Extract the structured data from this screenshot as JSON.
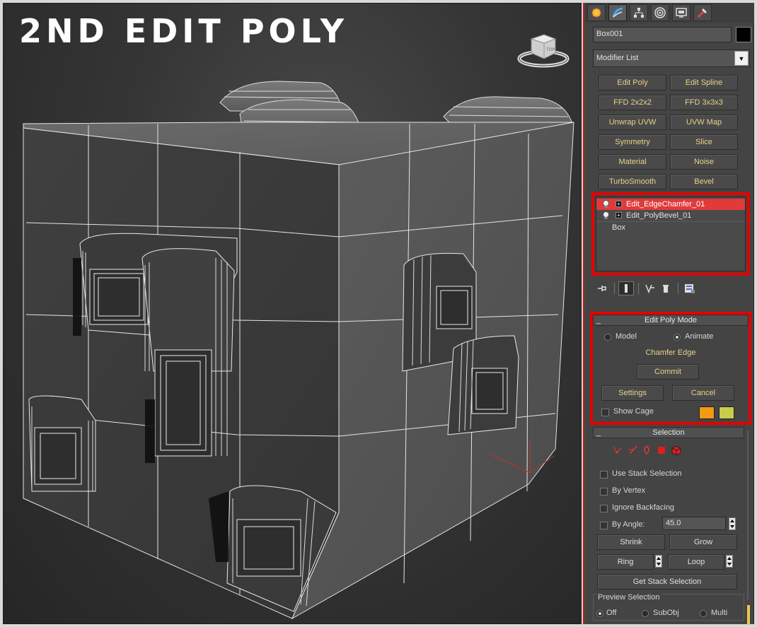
{
  "viewport": {
    "title": "2ND EDIT POLY",
    "viewcube_label": "TOP"
  },
  "panel": {
    "tabs": [
      {
        "icon": "create-icon"
      },
      {
        "icon": "modify-icon"
      },
      {
        "icon": "hierarchy-icon"
      },
      {
        "icon": "motion-icon"
      },
      {
        "icon": "display-icon"
      },
      {
        "icon": "utilities-icon"
      }
    ],
    "object_name": "Box001",
    "object_color": "#000000",
    "modifier_list": "Modifier List",
    "modifier_buttons": [
      "Edit Poly",
      "Edit Spline",
      "FFD 2x2x2",
      "FFD 3x3x3",
      "Unwrap UVW",
      "UVW Map",
      "Symmetry",
      "Slice",
      "Material",
      "Noise",
      "TurboSmooth",
      "Bevel"
    ],
    "stack": [
      {
        "label": "Edit_EdgeChamfer_01",
        "selected": true
      },
      {
        "label": "Edit_PolyBevel_01",
        "selected": false
      },
      {
        "label": "Box",
        "selected": false
      }
    ]
  },
  "edit_poly_mode": {
    "title": "Edit Poly Mode",
    "model_label": "Model",
    "animate_label": "Animate",
    "current_op": "Chamfer Edge",
    "commit_label": "Commit",
    "settings_label": "Settings",
    "cancel_label": "Cancel",
    "show_cage_label": "Show Cage",
    "cage_color_1": "#f39a13",
    "cage_color_2": "#c9cc4a"
  },
  "selection": {
    "title": "Selection",
    "use_stack_label": "Use Stack Selection",
    "by_vertex_label": "By Vertex",
    "ignore_backfacing_label": "Ignore Backfacing",
    "by_angle_label": "By Angle:",
    "by_angle_value": "45.0",
    "shrink_label": "Shrink",
    "grow_label": "Grow",
    "ring_label": "Ring",
    "loop_label": "Loop",
    "get_stack_label": "Get Stack Selection",
    "preview_label": "Preview Selection",
    "preview_off": "Off",
    "preview_subobj": "SubObj",
    "preview_multi": "Multi"
  },
  "colors": {
    "accent_red": "#e60000",
    "label_gold": "#e8d28a",
    "stack_selected": "#e13a3a"
  }
}
